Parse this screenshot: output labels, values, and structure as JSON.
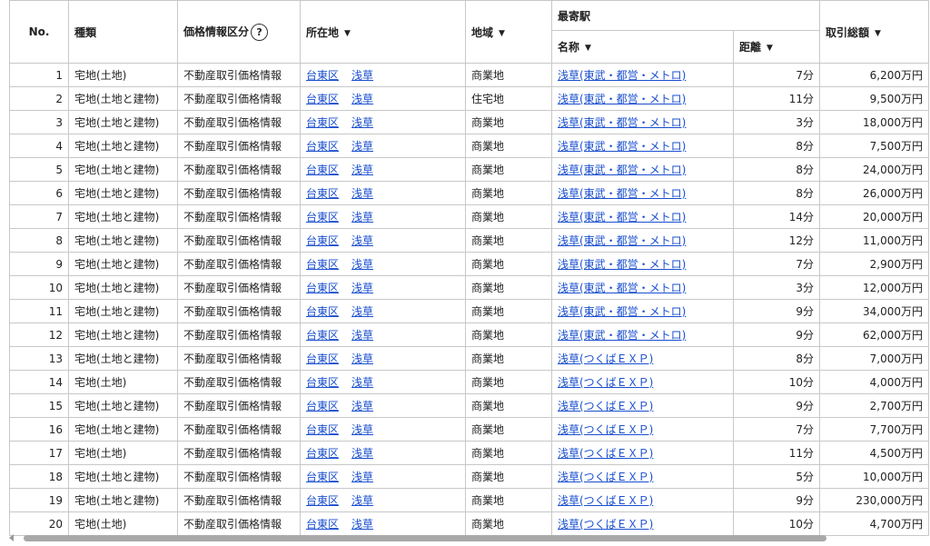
{
  "headers": {
    "no": "No.",
    "type": "種類",
    "price_info": "価格情報区分",
    "help_icon": "?",
    "location": "所在地",
    "area": "地域",
    "nearest_station": "最寄駅",
    "station_name": "名称",
    "distance": "距離",
    "total": "取引総額"
  },
  "rows": [
    {
      "no": "1",
      "type": "宅地(土地)",
      "info": "不動産取引価格情報",
      "ward": "台東区",
      "town": "浅草",
      "area": "商業地",
      "station": "浅草(東武・都営・メトロ)",
      "dist": "7分",
      "total": "6,200万円"
    },
    {
      "no": "2",
      "type": "宅地(土地と建物)",
      "info": "不動産取引価格情報",
      "ward": "台東区",
      "town": "浅草",
      "area": "住宅地",
      "station": "浅草(東武・都営・メトロ)",
      "dist": "11分",
      "total": "9,500万円"
    },
    {
      "no": "3",
      "type": "宅地(土地と建物)",
      "info": "不動産取引価格情報",
      "ward": "台東区",
      "town": "浅草",
      "area": "商業地",
      "station": "浅草(東武・都営・メトロ)",
      "dist": "3分",
      "total": "18,000万円"
    },
    {
      "no": "4",
      "type": "宅地(土地と建物)",
      "info": "不動産取引価格情報",
      "ward": "台東区",
      "town": "浅草",
      "area": "商業地",
      "station": "浅草(東武・都営・メトロ)",
      "dist": "8分",
      "total": "7,500万円"
    },
    {
      "no": "5",
      "type": "宅地(土地と建物)",
      "info": "不動産取引価格情報",
      "ward": "台東区",
      "town": "浅草",
      "area": "商業地",
      "station": "浅草(東武・都営・メトロ)",
      "dist": "8分",
      "total": "24,000万円"
    },
    {
      "no": "6",
      "type": "宅地(土地と建物)",
      "info": "不動産取引価格情報",
      "ward": "台東区",
      "town": "浅草",
      "area": "商業地",
      "station": "浅草(東武・都営・メトロ)",
      "dist": "8分",
      "total": "26,000万円"
    },
    {
      "no": "7",
      "type": "宅地(土地と建物)",
      "info": "不動産取引価格情報",
      "ward": "台東区",
      "town": "浅草",
      "area": "商業地",
      "station": "浅草(東武・都営・メトロ)",
      "dist": "14分",
      "total": "20,000万円"
    },
    {
      "no": "8",
      "type": "宅地(土地と建物)",
      "info": "不動産取引価格情報",
      "ward": "台東区",
      "town": "浅草",
      "area": "商業地",
      "station": "浅草(東武・都営・メトロ)",
      "dist": "12分",
      "total": "11,000万円"
    },
    {
      "no": "9",
      "type": "宅地(土地と建物)",
      "info": "不動産取引価格情報",
      "ward": "台東区",
      "town": "浅草",
      "area": "商業地",
      "station": "浅草(東武・都営・メトロ)",
      "dist": "7分",
      "total": "2,900万円"
    },
    {
      "no": "10",
      "type": "宅地(土地と建物)",
      "info": "不動産取引価格情報",
      "ward": "台東区",
      "town": "浅草",
      "area": "商業地",
      "station": "浅草(東武・都営・メトロ)",
      "dist": "3分",
      "total": "12,000万円"
    },
    {
      "no": "11",
      "type": "宅地(土地と建物)",
      "info": "不動産取引価格情報",
      "ward": "台東区",
      "town": "浅草",
      "area": "商業地",
      "station": "浅草(東武・都営・メトロ)",
      "dist": "9分",
      "total": "34,000万円"
    },
    {
      "no": "12",
      "type": "宅地(土地と建物)",
      "info": "不動産取引価格情報",
      "ward": "台東区",
      "town": "浅草",
      "area": "商業地",
      "station": "浅草(東武・都営・メトロ)",
      "dist": "9分",
      "total": "62,000万円"
    },
    {
      "no": "13",
      "type": "宅地(土地と建物)",
      "info": "不動産取引価格情報",
      "ward": "台東区",
      "town": "浅草",
      "area": "商業地",
      "station": "浅草(つくばＥＸＰ)",
      "dist": "8分",
      "total": "7,000万円"
    },
    {
      "no": "14",
      "type": "宅地(土地)",
      "info": "不動産取引価格情報",
      "ward": "台東区",
      "town": "浅草",
      "area": "商業地",
      "station": "浅草(つくばＥＸＰ)",
      "dist": "10分",
      "total": "4,000万円"
    },
    {
      "no": "15",
      "type": "宅地(土地と建物)",
      "info": "不動産取引価格情報",
      "ward": "台東区",
      "town": "浅草",
      "area": "商業地",
      "station": "浅草(つくばＥＸＰ)",
      "dist": "9分",
      "total": "2,700万円"
    },
    {
      "no": "16",
      "type": "宅地(土地と建物)",
      "info": "不動産取引価格情報",
      "ward": "台東区",
      "town": "浅草",
      "area": "商業地",
      "station": "浅草(つくばＥＸＰ)",
      "dist": "7分",
      "total": "7,700万円"
    },
    {
      "no": "17",
      "type": "宅地(土地)",
      "info": "不動産取引価格情報",
      "ward": "台東区",
      "town": "浅草",
      "area": "商業地",
      "station": "浅草(つくばＥＸＰ)",
      "dist": "11分",
      "total": "4,500万円"
    },
    {
      "no": "18",
      "type": "宅地(土地と建物)",
      "info": "不動産取引価格情報",
      "ward": "台東区",
      "town": "浅草",
      "area": "商業地",
      "station": "浅草(つくばＥＸＰ)",
      "dist": "5分",
      "total": "10,000万円"
    },
    {
      "no": "19",
      "type": "宅地(土地と建物)",
      "info": "不動産取引価格情報",
      "ward": "台東区",
      "town": "浅草",
      "area": "商業地",
      "station": "浅草(つくばＥＸＰ)",
      "dist": "9分",
      "total": "230,000万円"
    },
    {
      "no": "20",
      "type": "宅地(土地)",
      "info": "不動産取引価格情報",
      "ward": "台東区",
      "town": "浅草",
      "area": "商業地",
      "station": "浅草(つくばＥＸＰ)",
      "dist": "10分",
      "total": "4,700万円"
    }
  ],
  "colors": {
    "link": "#1a4fcf",
    "border": "#c8c8c8",
    "scroll_thumb": "#a9a9a9"
  }
}
